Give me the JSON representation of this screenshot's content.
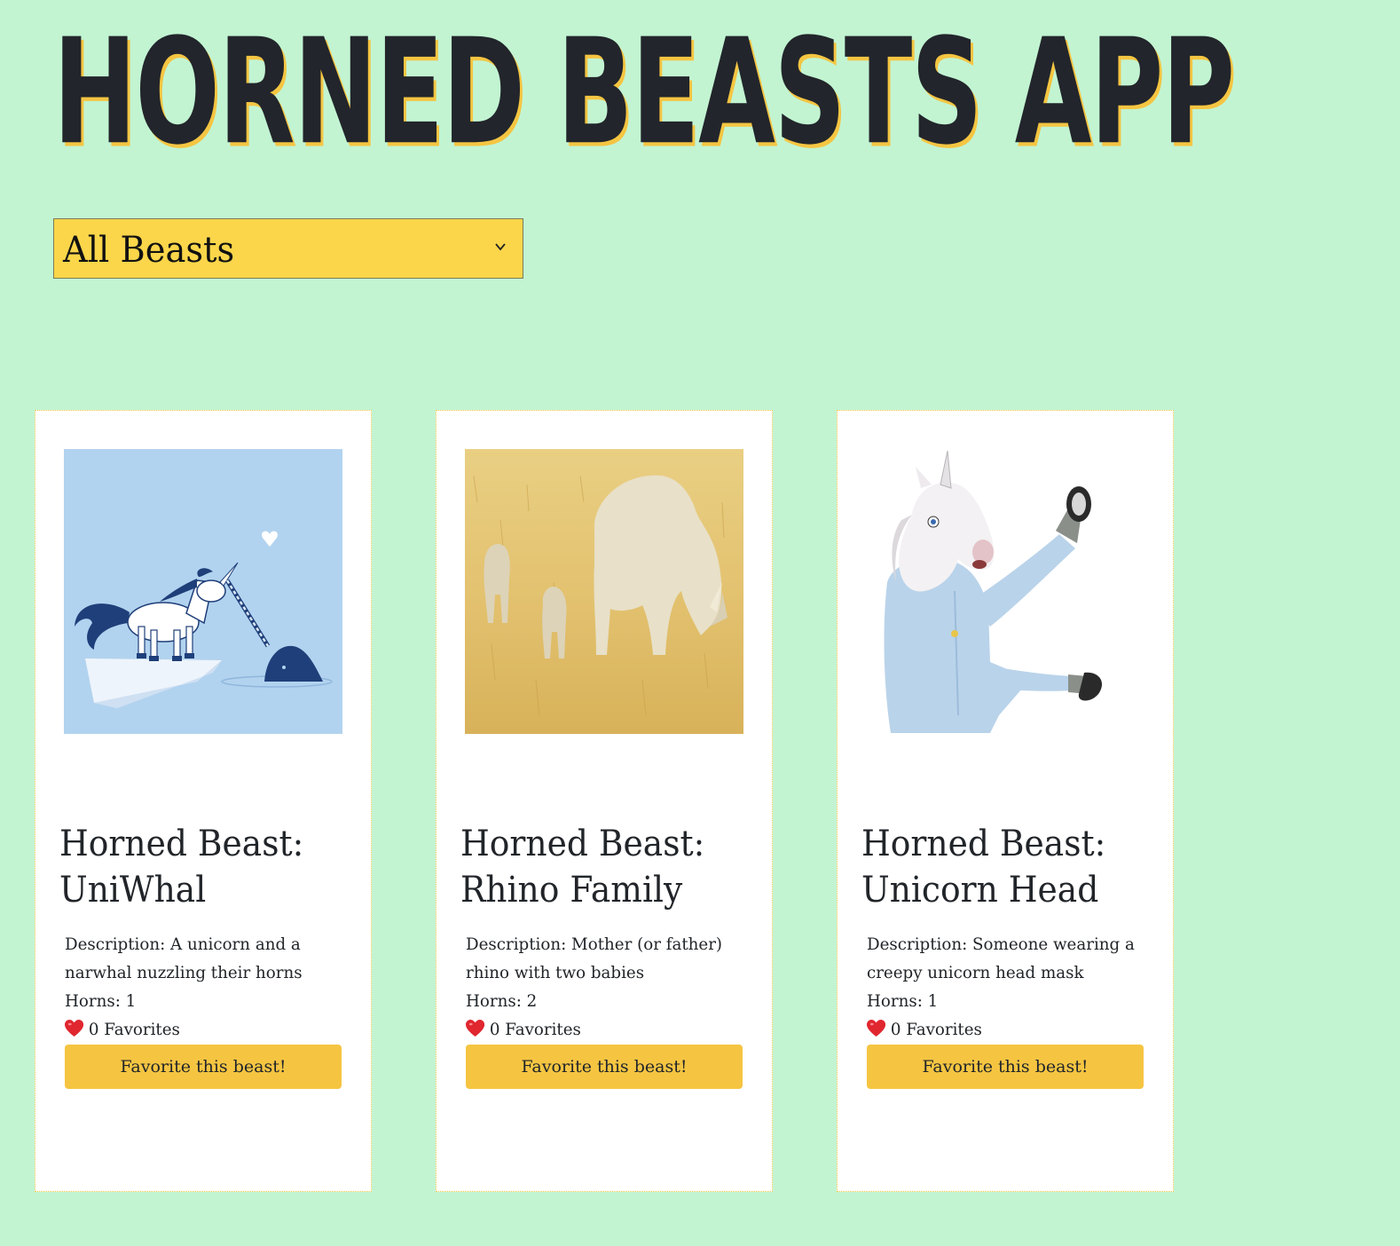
{
  "header": {
    "title": "HORNED BEASTS APP"
  },
  "filter": {
    "selected": "All Beasts"
  },
  "beasts": [
    {
      "title": "Horned Beast: UniWhal",
      "description": "Description: A unicorn and a narwhal nuzzling their horns",
      "description_line1": "Description: A unicorn and a",
      "description_line2": "narwhal nuzzling their horns",
      "horns": "Horns: 1",
      "favorites": "0 Favorites",
      "button_label": "Favorite this beast!"
    },
    {
      "title": "Horned Beast: Rhino Family",
      "description": "Description: Mother (or father) rhino with two babies",
      "description_line1": "Description: Mother (or father)",
      "description_line2": "rhino with two babies",
      "horns": "Horns: 2",
      "favorites": "0 Favorites",
      "button_label": "Favorite this beast!"
    },
    {
      "title": "Horned Beast: Unicorn Head",
      "description": "Description: Someone wearing a creepy unicorn head mask",
      "description_line1": "Description: Someone wearing a",
      "description_line2": "creepy unicorn head mask",
      "horns": "Horns: 1",
      "favorites": "0 Favorites",
      "button_label": "Favorite this beast!"
    }
  ],
  "colors": {
    "background": "#c2f4d2",
    "accent": "#f5c542",
    "select_bg": "#fbd64a",
    "text": "#212529"
  }
}
